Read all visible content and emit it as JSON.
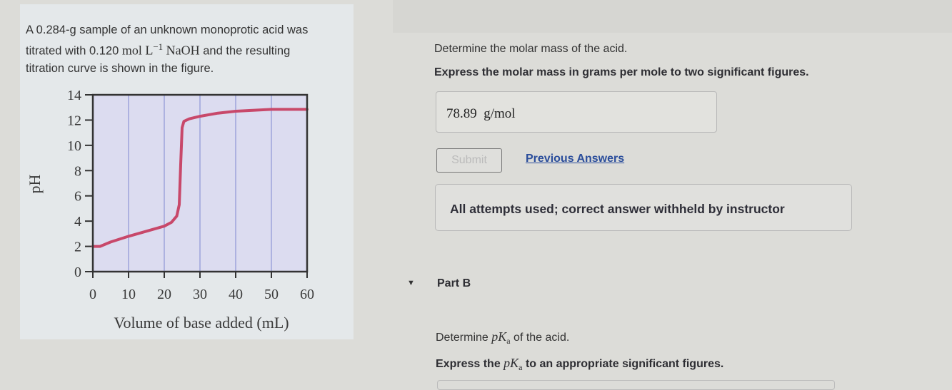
{
  "problem": {
    "line1": "A 0.284-g sample of an unknown monoprotic acid was",
    "line2_pre": "titrated with 0.120 ",
    "line2_unit": "mol L",
    "line2_sup": "−1",
    "line2_base": " NaOH",
    "line2_post": " and the resulting",
    "line3": "titration curve is shown in the figure."
  },
  "chart_data": {
    "type": "line",
    "xlabel": "Volume of base added (mL)",
    "ylabel": "pH",
    "xlim": [
      0,
      60
    ],
    "ylim": [
      0,
      14
    ],
    "xticks": [
      0,
      10,
      20,
      30,
      40,
      50,
      60
    ],
    "yticks": [
      0,
      2,
      4,
      6,
      8,
      10,
      12,
      14
    ],
    "grid": "vertical",
    "line_color": "#c8486a",
    "plot_background": "#dcdcf0",
    "series": [
      {
        "x": [
          0,
          2,
          5,
          10,
          15,
          20,
          22,
          23.5,
          24.2,
          24.6,
          25,
          25.5,
          27,
          30,
          35,
          40,
          50,
          60
        ],
        "y": [
          2.0,
          2.0,
          2.35,
          2.8,
          3.2,
          3.6,
          3.9,
          4.4,
          5.3,
          8.5,
          11.4,
          11.9,
          12.1,
          12.3,
          12.55,
          12.7,
          12.85,
          12.85
        ]
      }
    ]
  },
  "partA": {
    "question": "Determine the molar mass of the acid.",
    "instruction": "Express the molar mass in grams per mole to two significant figures.",
    "answer_value": "78.89",
    "answer_unit": "g/mol",
    "submit_label": "Submit",
    "previous_answers_label": "Previous Answers",
    "feedback": "All attempts used; correct answer withheld by instructor"
  },
  "partB": {
    "title": "Part B",
    "question_pre": "Determine ",
    "question_math": "pK",
    "question_sub": "a",
    "question_post": " of the acid.",
    "instruction_pre": "Express the ",
    "instruction_math": "pK",
    "instruction_sub": "a",
    "instruction_post": " to an appropriate significant figures."
  }
}
